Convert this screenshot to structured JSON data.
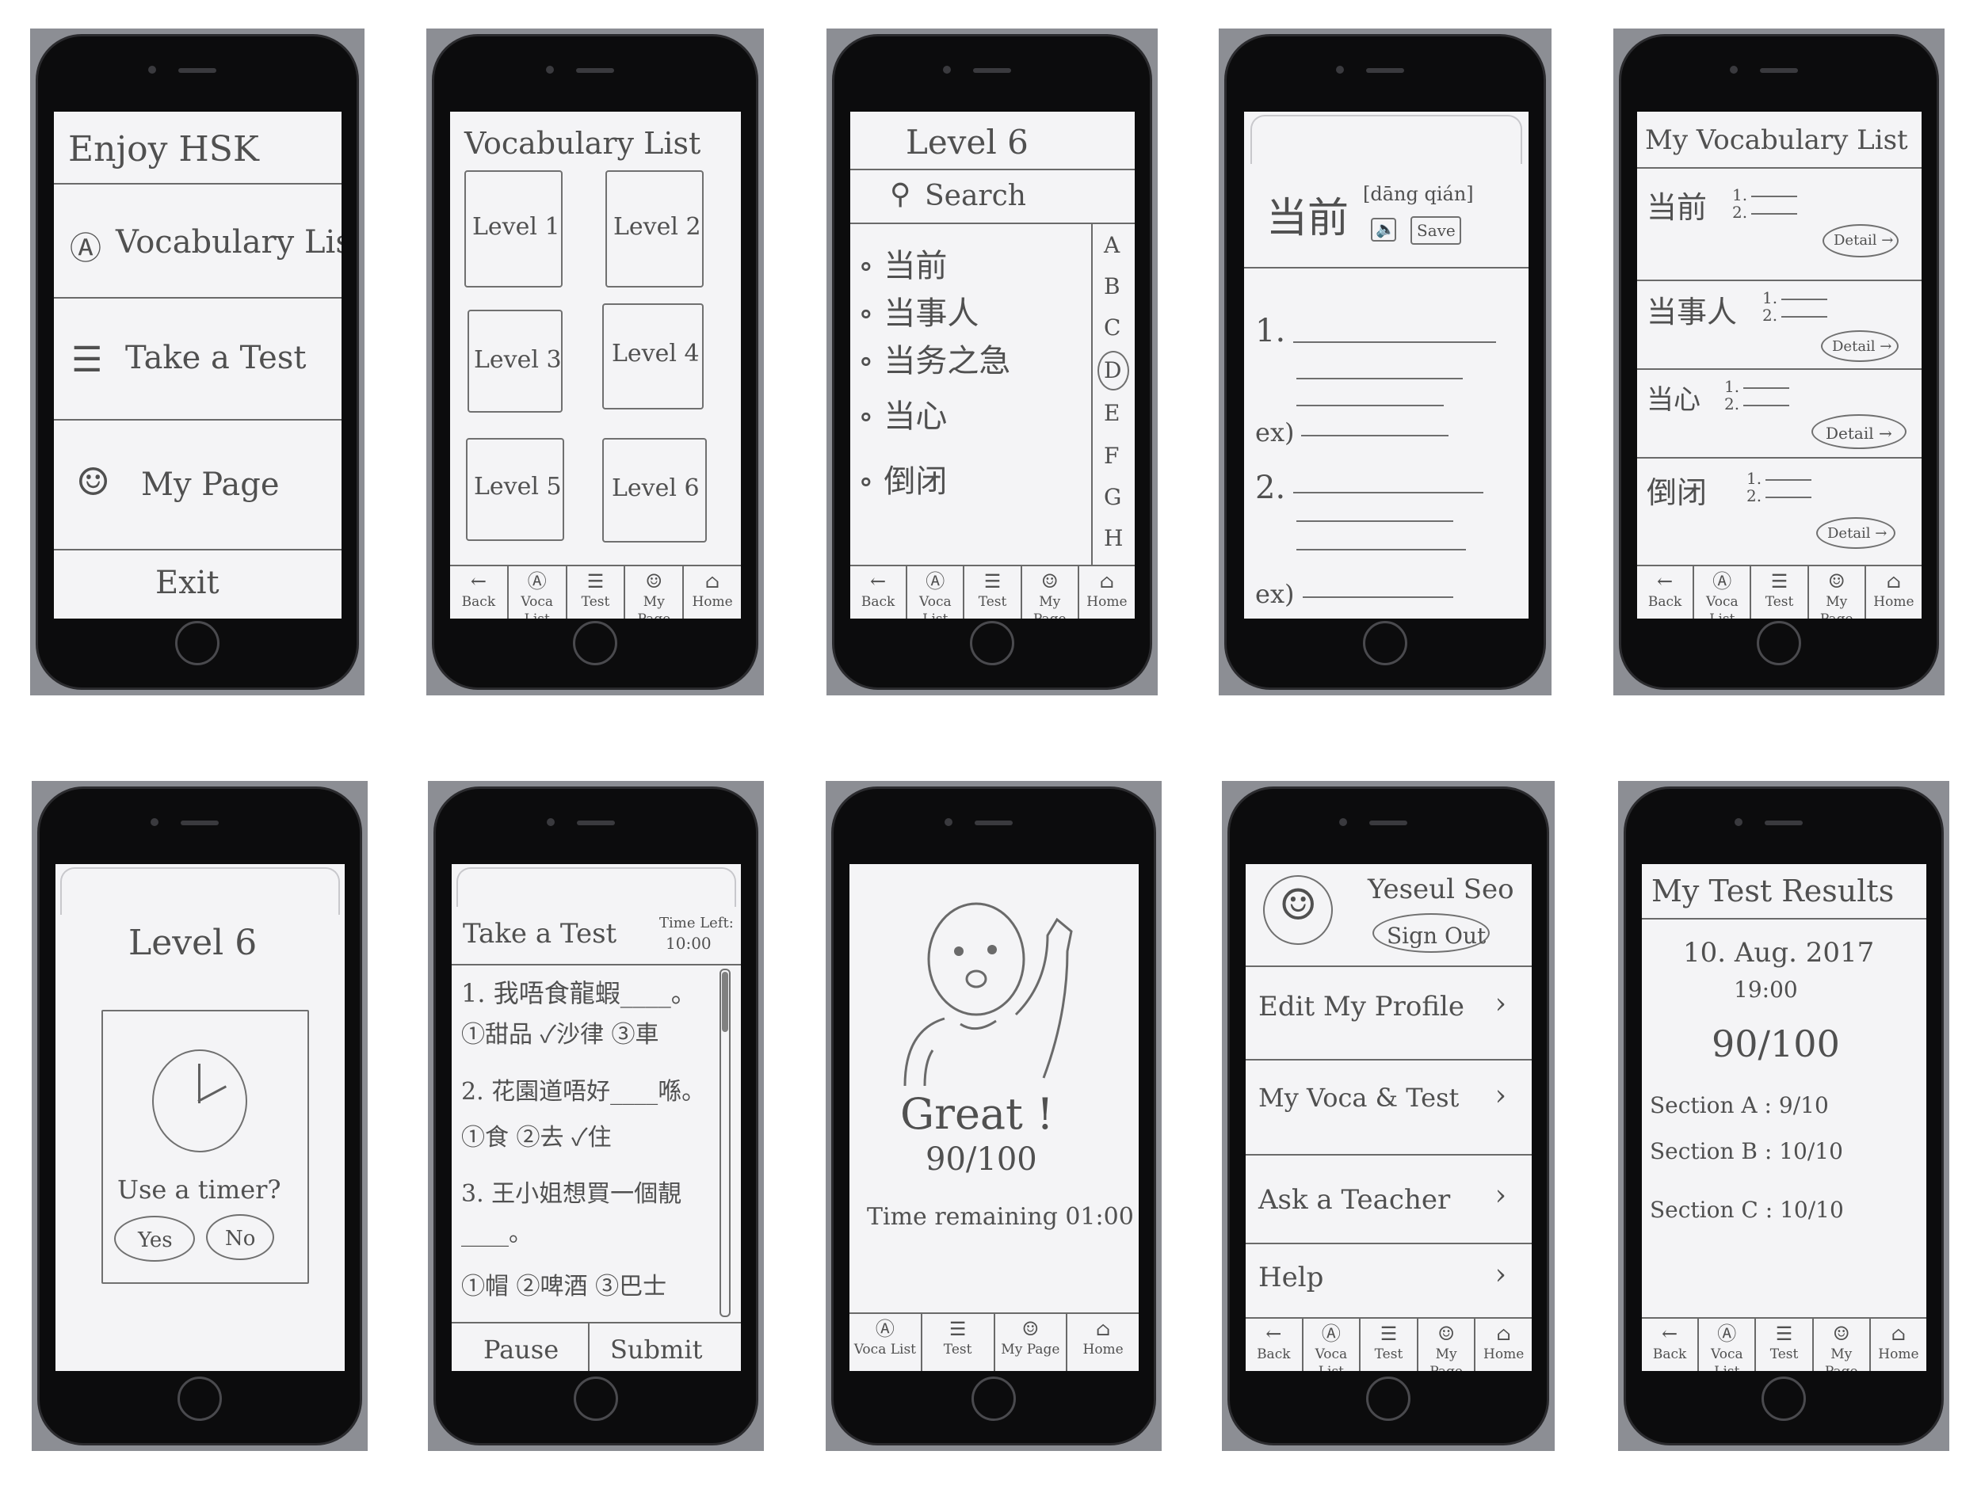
{
  "screens": {
    "home": {
      "title": "Enjoy HSK",
      "menu": [
        {
          "icon": "Ⓐ",
          "label": "Vocabulary List"
        },
        {
          "icon": "☰",
          "label": "Take a Test"
        },
        {
          "icon": "☺",
          "label": "My Page"
        }
      ],
      "exit_label": "Exit"
    },
    "vocab_levels": {
      "title": "Vocabulary List",
      "levels": [
        "Level 1",
        "Level 2",
        "Level 3",
        "Level 4",
        "Level 5",
        "Level 6"
      ]
    },
    "level6_words": {
      "title": "Level 6",
      "search_label": "Search",
      "words": [
        "当前",
        "当事人",
        "当务之急",
        "当心",
        "倒闭"
      ],
      "index_letters": [
        "A",
        "B",
        "C",
        "D",
        "E",
        "F",
        "G",
        "H"
      ],
      "selected_letter": "D"
    },
    "word_detail": {
      "word": "当前",
      "pinyin": "[dāng qián]",
      "save_label": "Save",
      "defs": [
        "1.",
        "ex)",
        "2.",
        "ex)"
      ]
    },
    "my_vocab": {
      "title": "My Vocabulary List",
      "entries": [
        {
          "word": "当前",
          "detail": "Detail →"
        },
        {
          "word": "当事人",
          "detail": "Detail →"
        },
        {
          "word": "当心",
          "detail": "Detail →"
        },
        {
          "word": "倒闭",
          "detail": "Detail →"
        }
      ]
    },
    "timer_prompt": {
      "title": "Level 6",
      "question": "Use a timer?",
      "yes_label": "Yes",
      "no_label": "No"
    },
    "take_test": {
      "title": "Take a Test",
      "time_left_label": "Time Left:",
      "time_left_value": "10:00",
      "questions": [
        {
          "q": "1. 我唔食龍蝦____。",
          "opts": "①甜品 ✓沙律 ③車"
        },
        {
          "q": "2. 花園道唔好____喺。",
          "opts": "①食 ②去 ✓住"
        },
        {
          "q": "3. 王小姐想買一個靚____。",
          "opts": "①帽 ②啤酒 ③巴士"
        }
      ],
      "pause_label": "Pause",
      "submit_label": "Submit"
    },
    "result": {
      "message": "Great !",
      "score": "90/100",
      "time_remaining": "Time remaining 01:00"
    },
    "my_page": {
      "user_name": "Yeseul Seo",
      "sign_out_label": "Sign Out",
      "menu": [
        "Edit My Profile",
        "My Voca & Test",
        "Ask a Teacher",
        "Help"
      ]
    },
    "test_results": {
      "title": "My Test Results",
      "date": "10. Aug. 2017",
      "time": "19:00",
      "score": "90/100",
      "sections": [
        "Section A : 9/10",
        "Section B : 10/10",
        "Section C : 10/10"
      ]
    }
  },
  "tabs": {
    "back": {
      "icon": "←",
      "label": "Back"
    },
    "voca": {
      "icon": "Ⓐ",
      "label": "Voca List"
    },
    "test": {
      "icon": "☰",
      "label": "Test"
    },
    "mypage": {
      "icon": "☺",
      "label": "My Page"
    },
    "home": {
      "icon": "⌂",
      "label": "Home"
    }
  }
}
